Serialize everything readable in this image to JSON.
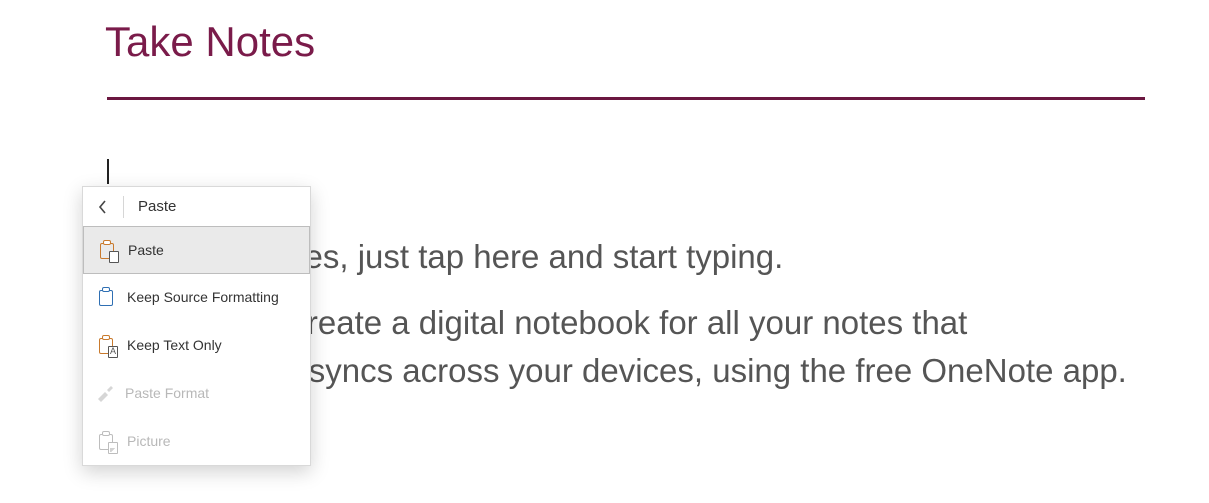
{
  "title": "Take Notes",
  "body": {
    "p1": "1. To take notes, just tap here and start typing.",
    "p2": "2. Or, easily create a digital notebook for all your notes that automatically syncs across your devices, using the free OneNote app."
  },
  "menu": {
    "header": "Paste",
    "items": [
      {
        "label": "Paste"
      },
      {
        "label": "Keep Source Formatting"
      },
      {
        "label": "Keep Text Only"
      },
      {
        "label": "Paste Format"
      },
      {
        "label": "Picture"
      }
    ]
  }
}
